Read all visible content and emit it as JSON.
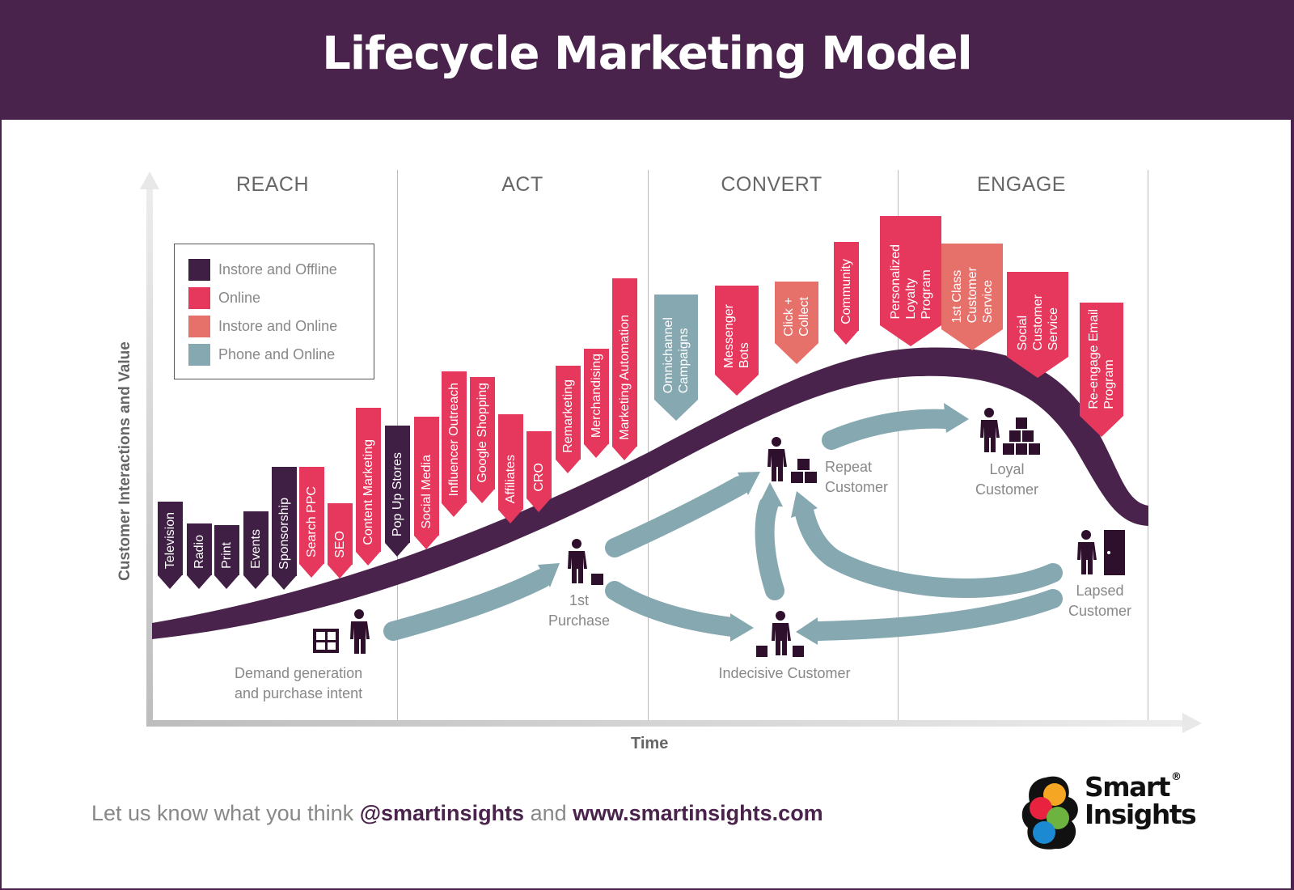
{
  "title": "Lifecycle Marketing Model",
  "phases": [
    "REACH",
    "ACT",
    "CONVERT",
    "ENGAGE"
  ],
  "axes": {
    "y_label": "Customer Interactions and Value",
    "x_label": "Time"
  },
  "colors": {
    "brand": "#4a234c",
    "instore_offline": "#3f1f44",
    "online": "#e5385c",
    "instore_online": "#e6706a",
    "phone_online": "#86a8b1",
    "arrow": "#86a8b1",
    "icon": "#2e0f2c"
  },
  "legend": [
    {
      "label": "Instore and Offline",
      "color": "#3f1f44"
    },
    {
      "label": "Online",
      "color": "#e5385c"
    },
    {
      "label": "Instore and Online",
      "color": "#e6706a"
    },
    {
      "label": "Phone and Online",
      "color": "#86a8b1"
    }
  ],
  "flags": [
    {
      "label": "Television",
      "channel": "instore_offline"
    },
    {
      "label": "Radio",
      "channel": "instore_offline"
    },
    {
      "label": "Print",
      "channel": "instore_offline"
    },
    {
      "label": "Events",
      "channel": "instore_offline"
    },
    {
      "label": "Sponsorship",
      "channel": "instore_offline"
    },
    {
      "label": "Search PPC",
      "channel": "online"
    },
    {
      "label": "SEO",
      "channel": "online"
    },
    {
      "label": "Content Marketing",
      "channel": "online"
    },
    {
      "label": "Pop Up Stores",
      "channel": "instore_offline"
    },
    {
      "label": "Social Media",
      "channel": "online"
    },
    {
      "label": "Influencer Outreach",
      "channel": "online"
    },
    {
      "label": "Google Shopping",
      "channel": "online"
    },
    {
      "label": "Affiliates",
      "channel": "online"
    },
    {
      "label": "CRO",
      "channel": "online"
    },
    {
      "label": "Remarketing",
      "channel": "online"
    },
    {
      "label": "Merchandising",
      "channel": "online"
    },
    {
      "label": "Marketing Automation",
      "channel": "online"
    },
    {
      "label": "Omnichannel\nCampaigns",
      "channel": "phone_online"
    },
    {
      "label": "Messenger\nBots",
      "channel": "online"
    },
    {
      "label": "Click +\nCollect",
      "channel": "instore_online"
    },
    {
      "label": "Community",
      "channel": "online"
    },
    {
      "label": "Personalized\nLoyalty\nProgram",
      "channel": "online"
    },
    {
      "label": "1st Class\nCustomer\nService",
      "channel": "instore_online"
    },
    {
      "label": "Social\nCustomer\nService",
      "channel": "online"
    },
    {
      "label": "Re-engage Email\nProgram",
      "channel": "online"
    }
  ],
  "stages": [
    {
      "label": "Demand generation\nand purchase intent",
      "icon": "person-window-icon"
    },
    {
      "label": "1st\nPurchase",
      "icon": "person-one-box-icon"
    },
    {
      "label": "Repeat\nCustomer",
      "icon": "person-three-boxes-icon"
    },
    {
      "label": "Indecisive Customer",
      "icon": "person-two-boxes-icon"
    },
    {
      "label": "Loyal\nCustomer",
      "icon": "person-box-pyramid-icon"
    },
    {
      "label": "Lapsed\nCustomer",
      "icon": "person-door-icon"
    }
  ],
  "footer": {
    "prefix": "Let us know what you think ",
    "handle": "@smartinsights",
    "middle": " and ",
    "url": "www.smartinsights.com"
  },
  "logo": {
    "line1": "Smart",
    "line2": "Insights",
    "mark": "®"
  }
}
